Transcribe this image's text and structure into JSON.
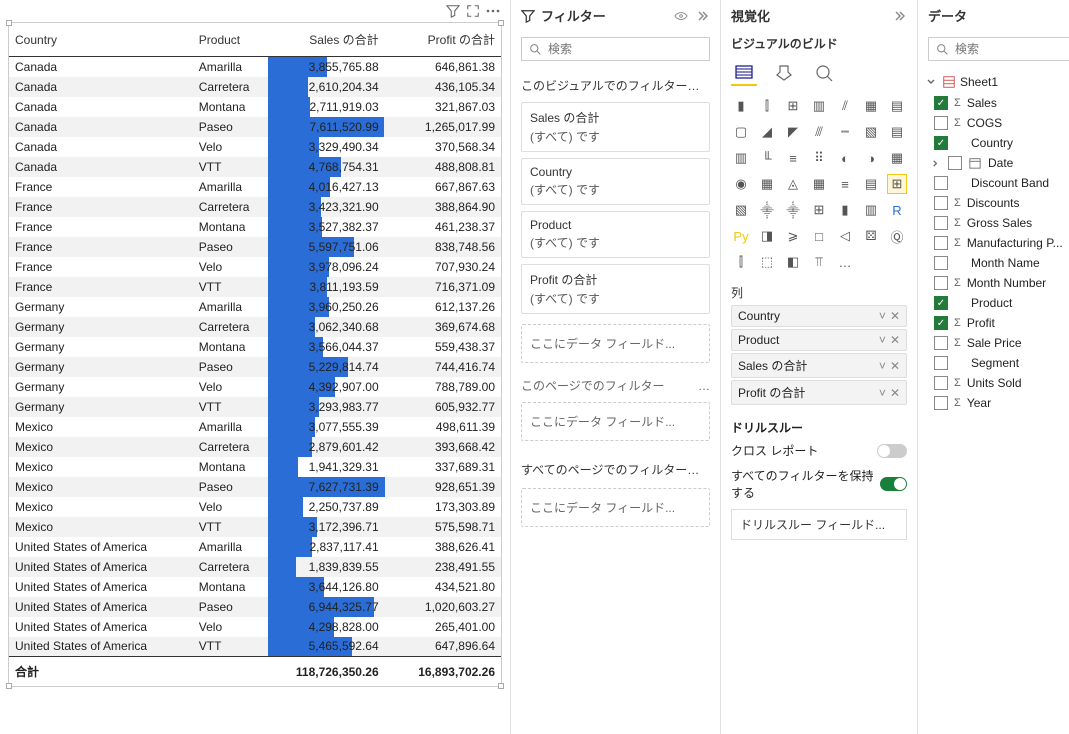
{
  "toolbar": {
    "filter_icon": "filter",
    "focus_icon": "expand",
    "more_icon": "more"
  },
  "table": {
    "headers": {
      "country": "Country",
      "product": "Product",
      "sales": "Sales の合計",
      "profit": "Profit の合計"
    },
    "max_sales": 7627731.39,
    "rows": [
      {
        "c": "Canada",
        "p": "Amarilla",
        "s": "3,855,765.88",
        "pr": "646,861.38",
        "v": 3855765.88
      },
      {
        "c": "Canada",
        "p": "Carretera",
        "s": "2,610,204.34",
        "pr": "436,105.34",
        "v": 2610204.34
      },
      {
        "c": "Canada",
        "p": "Montana",
        "s": "2,711,919.03",
        "pr": "321,867.03",
        "v": 2711919.03
      },
      {
        "c": "Canada",
        "p": "Paseo",
        "s": "7,611,520.99",
        "pr": "1,265,017.99",
        "v": 7611520.99
      },
      {
        "c": "Canada",
        "p": "Velo",
        "s": "3,329,490.34",
        "pr": "370,568.34",
        "v": 3329490.34
      },
      {
        "c": "Canada",
        "p": "VTT",
        "s": "4,768,754.31",
        "pr": "488,808.81",
        "v": 4768754.31
      },
      {
        "c": "France",
        "p": "Amarilla",
        "s": "4,016,427.13",
        "pr": "667,867.63",
        "v": 4016427.13
      },
      {
        "c": "France",
        "p": "Carretera",
        "s": "3,423,321.90",
        "pr": "388,864.90",
        "v": 3423321.9
      },
      {
        "c": "France",
        "p": "Montana",
        "s": "3,527,382.37",
        "pr": "461,238.37",
        "v": 3527382.37
      },
      {
        "c": "France",
        "p": "Paseo",
        "s": "5,597,751.06",
        "pr": "838,748.56",
        "v": 5597751.06
      },
      {
        "c": "France",
        "p": "Velo",
        "s": "3,978,096.24",
        "pr": "707,930.24",
        "v": 3978096.24
      },
      {
        "c": "France",
        "p": "VTT",
        "s": "3,811,193.59",
        "pr": "716,371.09",
        "v": 3811193.59
      },
      {
        "c": "Germany",
        "p": "Amarilla",
        "s": "3,960,250.26",
        "pr": "612,137.26",
        "v": 3960250.26
      },
      {
        "c": "Germany",
        "p": "Carretera",
        "s": "3,062,340.68",
        "pr": "369,674.68",
        "v": 3062340.68
      },
      {
        "c": "Germany",
        "p": "Montana",
        "s": "3,566,044.37",
        "pr": "559,438.37",
        "v": 3566044.37
      },
      {
        "c": "Germany",
        "p": "Paseo",
        "s": "5,229,814.74",
        "pr": "744,416.74",
        "v": 5229814.74
      },
      {
        "c": "Germany",
        "p": "Velo",
        "s": "4,392,907.00",
        "pr": "788,789.00",
        "v": 4392907.0
      },
      {
        "c": "Germany",
        "p": "VTT",
        "s": "3,293,983.77",
        "pr": "605,932.77",
        "v": 3293983.77
      },
      {
        "c": "Mexico",
        "p": "Amarilla",
        "s": "3,077,555.39",
        "pr": "498,611.39",
        "v": 3077555.39
      },
      {
        "c": "Mexico",
        "p": "Carretera",
        "s": "2,879,601.42",
        "pr": "393,668.42",
        "v": 2879601.42
      },
      {
        "c": "Mexico",
        "p": "Montana",
        "s": "1,941,329.31",
        "pr": "337,689.31",
        "v": 1941329.31
      },
      {
        "c": "Mexico",
        "p": "Paseo",
        "s": "7,627,731.39",
        "pr": "928,651.39",
        "v": 7627731.39
      },
      {
        "c": "Mexico",
        "p": "Velo",
        "s": "2,250,737.89",
        "pr": "173,303.89",
        "v": 2250737.89
      },
      {
        "c": "Mexico",
        "p": "VTT",
        "s": "3,172,396.71",
        "pr": "575,598.71",
        "v": 3172396.71
      },
      {
        "c": "United States of America",
        "p": "Amarilla",
        "s": "2,837,117.41",
        "pr": "388,626.41",
        "v": 2837117.41
      },
      {
        "c": "United States of America",
        "p": "Carretera",
        "s": "1,839,839.55",
        "pr": "238,491.55",
        "v": 1839839.55
      },
      {
        "c": "United States of America",
        "p": "Montana",
        "s": "3,644,126.80",
        "pr": "434,521.80",
        "v": 3644126.8
      },
      {
        "c": "United States of America",
        "p": "Paseo",
        "s": "6,944,325.77",
        "pr": "1,020,603.27",
        "v": 6944325.77
      },
      {
        "c": "United States of America",
        "p": "Velo",
        "s": "4,298,828.00",
        "pr": "265,401.00",
        "v": 4298828.0
      },
      {
        "c": "United States of America",
        "p": "VTT",
        "s": "5,465,592.64",
        "pr": "647,896.64",
        "v": 5465592.64
      }
    ],
    "total": {
      "label": "合計",
      "sales": "118,726,350.26",
      "profit": "16,893,702.26"
    }
  },
  "filters": {
    "title": "フィルター",
    "search_placeholder": "検索",
    "visual_filters_title": "このビジュアルでのフィルター…",
    "cards": [
      {
        "name": "Sales の合計",
        "value": "(すべて) です"
      },
      {
        "name": "Country",
        "value": "(すべて) です"
      },
      {
        "name": "Product",
        "value": "(すべて) です"
      },
      {
        "name": "Profit の合計",
        "value": "(すべて) です"
      }
    ],
    "drop_text": "ここにデータ フィールド...",
    "page_filters_title": "このページでのフィルター",
    "all_pages_title": "すべてのページでのフィルター…"
  },
  "viz": {
    "title": "視覚化",
    "build_title": "ビジュアルのビルド",
    "wells_title": "列",
    "wells": [
      "Country",
      "Product",
      "Sales の合計",
      "Profit の合計"
    ],
    "drill_title": "ドリルスルー",
    "cross_report": "クロス レポート",
    "keep_filters": "すべてのフィルターを保持する",
    "drill_field": "ドリルスルー フィールド..."
  },
  "data_panel": {
    "title": "データ",
    "search_placeholder": "検索",
    "root": "Sheet1",
    "date_field": "Date",
    "fields": [
      {
        "name": "Sales",
        "checked": true,
        "sigma": true
      },
      {
        "name": "COGS",
        "checked": false,
        "sigma": true
      },
      {
        "name": "Country",
        "checked": true,
        "sigma": false
      },
      {
        "name": "Discount Band",
        "checked": false,
        "sigma": false
      },
      {
        "name": "Discounts",
        "checked": false,
        "sigma": true
      },
      {
        "name": "Gross Sales",
        "checked": false,
        "sigma": true
      },
      {
        "name": "Manufacturing P...",
        "checked": false,
        "sigma": true
      },
      {
        "name": "Month Name",
        "checked": false,
        "sigma": false
      },
      {
        "name": "Month Number",
        "checked": false,
        "sigma": true
      },
      {
        "name": "Product",
        "checked": true,
        "sigma": false
      },
      {
        "name": "Profit",
        "checked": true,
        "sigma": true
      },
      {
        "name": "Sale Price",
        "checked": false,
        "sigma": true
      },
      {
        "name": "Segment",
        "checked": false,
        "sigma": false
      },
      {
        "name": "Units Sold",
        "checked": false,
        "sigma": true
      },
      {
        "name": "Year",
        "checked": false,
        "sigma": true
      }
    ]
  }
}
